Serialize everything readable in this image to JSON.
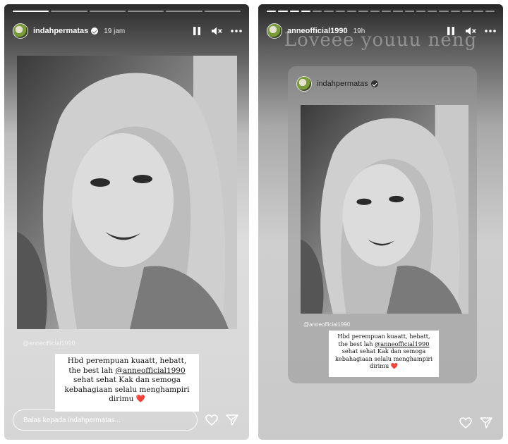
{
  "left_story": {
    "username": "indahpermatas",
    "time": "19 jam",
    "progress": {
      "total": 6,
      "active": 1
    },
    "mention_tag": "@anneofficial1990",
    "caption": {
      "line1": "Hbd perempuan kuaatt, hebatt,",
      "line2_before": "the best lah ",
      "line2_mention": "@anneofficial1990",
      "line3": "sehat sehat Kak dan semoga",
      "line4": "kebahagiaan selalu menghampiri",
      "line5": "dirimu",
      "heart": "❤️"
    },
    "reply_placeholder": "Balas kepada indahpermatas..."
  },
  "right_story": {
    "username": "anneofficial1990",
    "time": "19h",
    "progress": {
      "total": 20,
      "active": 4
    },
    "overlay_text": "Loveee youuu neng",
    "shared_username": "indahpermatas",
    "mention_tag": "@anneofficial1990",
    "caption": {
      "line1": "Hbd perempuan kuaatt, hebatt,",
      "line2_before": "the best lah ",
      "line2_mention": "@anneofficial1990",
      "line3": "sehat sehat Kak dan semoga",
      "line4": "kebahagiaan selalu menghampiri",
      "line5": "dirimu",
      "heart": "❤️"
    }
  },
  "icons": [
    "pause-icon",
    "mute-icon",
    "more-icon",
    "heart-icon",
    "send-icon",
    "verified-badge-icon"
  ],
  "colors": {
    "heart_red": "#c8102e",
    "caption_bg": "#ffffff"
  }
}
